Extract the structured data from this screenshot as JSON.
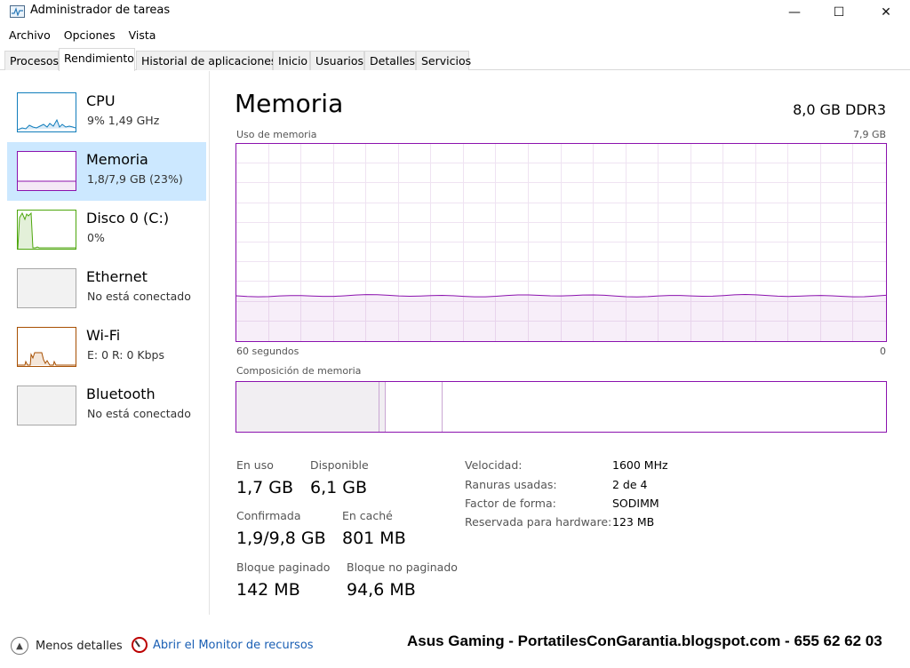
{
  "window": {
    "title": "Administrador de tareas",
    "minimize_glyph": "—",
    "maximize_glyph": "☐",
    "close_glyph": "✕"
  },
  "menu": [
    "Archivo",
    "Opciones",
    "Vista"
  ],
  "tabs": [
    "Procesos",
    "Rendimiento",
    "Historial de aplicaciones",
    "Inicio",
    "Usuarios",
    "Detalles",
    "Servicios"
  ],
  "active_tab": "Rendimiento",
  "sidebar": {
    "items": [
      {
        "title": "CPU",
        "subtitle": "9%  1,49 GHz",
        "color": "#117dbb"
      },
      {
        "title": "Memoria",
        "subtitle": "1,8/7,9 GB (23%)",
        "color": "#8b12ae"
      },
      {
        "title": "Disco 0 (C:)",
        "subtitle": "0%",
        "color": "#4da60c"
      },
      {
        "title": "Ethernet",
        "subtitle": "No está conectado",
        "color": "#a7a7a7"
      },
      {
        "title": "Wi-Fi",
        "subtitle": "E: 0 R: 0 Kbps",
        "color": "#a74f01"
      },
      {
        "title": "Bluetooth",
        "subtitle": "No está conectado",
        "color": "#a7a7a7"
      }
    ],
    "selected_index": 1
  },
  "main": {
    "title": "Memoria",
    "type": "8,0 GB DDR3",
    "usage_graph": {
      "label": "Uso de memoria",
      "max_label": "7,9 GB",
      "time_left": "60 segundos",
      "time_right": "0",
      "fill_level": 0.23,
      "line_color": "#8b12ae"
    },
    "composition": {
      "label": "Composición de memoria",
      "in_use_fraction": 0.22,
      "modified_fraction": 0.01,
      "standby_fraction": 0.088
    },
    "stats": {
      "en_uso_label": "En uso",
      "en_uso_value": "1,7 GB",
      "disponible_label": "Disponible",
      "disponible_value": "6,1 GB",
      "confirmada_label": "Confirmada",
      "confirmada_value": "1,9/9,8 GB",
      "en_cache_label": "En caché",
      "en_cache_value": "801 MB",
      "bloque_paginado_label": "Bloque paginado",
      "bloque_paginado_value": "142 MB",
      "bloque_no_paginado_label": "Bloque no paginado",
      "bloque_no_paginado_value": "94,6 MB"
    },
    "details": [
      {
        "label": "Velocidad:",
        "value": "1600 MHz"
      },
      {
        "label": "Ranuras usadas:",
        "value": "2 de 4"
      },
      {
        "label": "Factor de forma:",
        "value": "SODIMM"
      },
      {
        "label": "Reservada para hardware:",
        "value": "123 MB"
      }
    ]
  },
  "footer": {
    "less_details": "Menos detalles",
    "resource_monitor": "Abrir el Monitor de recursos",
    "watermark": "Asus Gaming - PortatilesConGarantia.blogspot.com - 655 62 62 03"
  }
}
